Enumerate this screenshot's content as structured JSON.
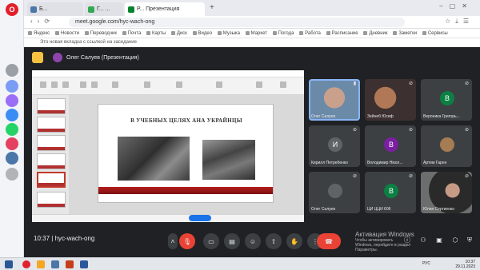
{
  "browser": {
    "tabs": [
      {
        "label": "Б...",
        "active": false
      },
      {
        "label": "Г... ...",
        "active": false
      },
      {
        "label": "Р... Презентация",
        "active": true
      }
    ],
    "url": "meet.google.com/hyc-wach-ong",
    "bookmarks": [
      "Яндекс",
      "Новости",
      "Переводчик",
      "Почта",
      "Карты",
      "Диск",
      "Видео",
      "Музыка",
      "Маркет",
      "Погода",
      "Работа",
      "Расписание",
      "Дневник",
      "Заметки",
      "Сервисы"
    ],
    "notification": "Это новая вкладка с ссылкой на заседание"
  },
  "meet": {
    "presenter": "Олег Салуев (Презентация)",
    "meeting_time": "10:37",
    "meeting_code": "hyc-wach-ong",
    "separator": "|"
  },
  "slide": {
    "title": "В УЧЕБНЫХ ЦЕЛЯХ АНА УКРАЙНЦЫ"
  },
  "participants": [
    {
      "name": "Олег Салуев",
      "initial": "",
      "avatar_color": "",
      "style": "photo-a",
      "muted": false,
      "active": true
    },
    {
      "name": "Зейнеб Юсиф",
      "initial": "",
      "avatar_color": "",
      "style": "photo-b",
      "muted": true,
      "active": false
    },
    {
      "name": "Вероника Григорь...",
      "initial": "В",
      "avatar_color": "#0b8043",
      "style": "",
      "muted": true,
      "active": false
    },
    {
      "name": "Кирилл Петребенко",
      "initial": "И",
      "avatar_color": "#5f6368",
      "style": "",
      "muted": true,
      "active": false
    },
    {
      "name": "Володимир Нікол...",
      "initial": "В",
      "avatar_color": "#7b1fa2",
      "style": "",
      "muted": true,
      "active": false
    },
    {
      "name": "Артем Гарен",
      "initial": "",
      "avatar_color": "#a67c52",
      "style": "",
      "muted": true,
      "active": false
    },
    {
      "name": "Олег Салуев",
      "initial": "",
      "avatar_color": "#5f6368",
      "style": "",
      "muted": true,
      "active": false
    },
    {
      "name": "ЦИ ЦЦИ 606",
      "initial": "В",
      "avatar_color": "#0b8043",
      "style": "",
      "muted": true,
      "active": false
    },
    {
      "name": "Юлия Сергиенко",
      "initial": "",
      "avatar_color": "",
      "style": "photo-c",
      "muted": true,
      "active": false
    }
  ],
  "windows_activation": {
    "title": "Активация Windows",
    "subtitle": "Чтобы активировать Windows, перейдите в раздел Параметры."
  },
  "taskbar": {
    "clock_time": "10:37",
    "clock_date": "29.11.2023",
    "lang": "РУС"
  },
  "icons": {
    "mic_off": "mic-off-icon",
    "camera": "camera-icon",
    "captions": "captions-icon",
    "emoji": "emoji-icon",
    "present": "present-icon",
    "hand": "raise-hand-icon",
    "more": "more-icon",
    "end_call": "end-call-icon"
  },
  "colors": {
    "meet_background": "#202124",
    "tile_background": "#3c4043",
    "end_call": "#ea4335",
    "slide_band": "#b51e1e"
  }
}
